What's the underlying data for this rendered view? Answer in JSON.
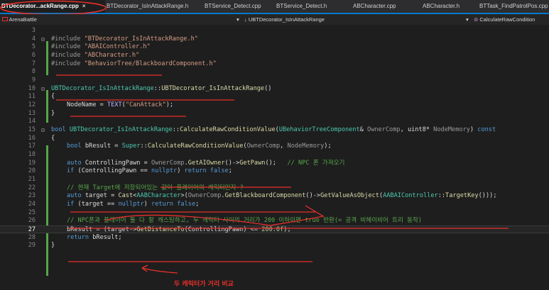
{
  "tabs": [
    {
      "label": "BTDecorator...ackRange.cpp",
      "active": true,
      "close": "×"
    },
    {
      "label": "BTDecorator_IsInAttackRange.h"
    },
    {
      "label": "BTService_Detect.cpp"
    },
    {
      "label": "BTService_Detect.h"
    },
    {
      "label": "ABCharacter.cpp"
    },
    {
      "label": "ABCharacter.h"
    },
    {
      "label": "BTTask_FindPatrolPos.cpp"
    }
  ],
  "navbar": {
    "project": "ArenaBattle",
    "scope": "UBTDecorator_IsInAttackRange",
    "member": "CalculateRawCondition"
  },
  "current_line": 27,
  "lines": [
    {
      "n": "3"
    },
    {
      "n": "4"
    },
    {
      "n": "5"
    },
    {
      "n": "6"
    },
    {
      "n": "7"
    },
    {
      "n": "8"
    },
    {
      "n": "9"
    },
    {
      "n": "10"
    },
    {
      "n": "11"
    },
    {
      "n": "12"
    },
    {
      "n": "13"
    },
    {
      "n": "14"
    },
    {
      "n": "15"
    },
    {
      "n": "16"
    },
    {
      "n": "17"
    },
    {
      "n": "18"
    },
    {
      "n": "19"
    },
    {
      "n": "20"
    },
    {
      "n": "21"
    },
    {
      "n": "22"
    },
    {
      "n": "23"
    },
    {
      "n": "24"
    },
    {
      "n": "25"
    },
    {
      "n": "26"
    },
    {
      "n": "27"
    },
    {
      "n": "28"
    },
    {
      "n": "29"
    }
  ],
  "code": {
    "l4_inc": "#include ",
    "l4_str": "\"BTDecorator_IsInAttackRange.h\"",
    "l5_inc": "#include ",
    "l5_str": "\"ABAIController.h\"",
    "l6_inc": "#include ",
    "l6_str": "\"ABCharacter.h\"",
    "l7_inc": "#include ",
    "l7_str": "\"BehaviorTree/BlackboardComponent.h\"",
    "l10_cls": "UBTDecorator_IsInAttackRange",
    "l10_sep": "::",
    "l10_fn": "UBTDecorator_IsInAttackRange",
    "l10_tail": "()",
    "l11": "{",
    "l12_a": "NodeName",
    "l12_b": " = ",
    "l12_mac": "TEXT",
    "l12_c": "(",
    "l12_str": "\"CanAttack\"",
    "l12_d": ");",
    "l13": "}",
    "l15_kw": "bool ",
    "l15_cls": "UBTDecorator_IsInAttackRange",
    "l15_sep": "::",
    "l15_fn": "CalculateRawConditionValue",
    "l15_p1": "(",
    "l15_cls2": "UBehaviorTreeComponent",
    "l15_p2": "& ",
    "l15_prm1": "OwnerComp",
    "l15_p3": ", uint8* ",
    "l15_prm2": "NodeMemory",
    "l15_p4": ") ",
    "l15_kw2": "const",
    "l16": "{",
    "l17_kw": "bool ",
    "l17_a": "bResult = ",
    "l17_cls": "Super",
    "l17_sep": "::",
    "l17_fn": "CalculateRawConditionValue",
    "l17_b": "(",
    "l17_prm1": "OwnerComp",
    "l17_c": ", ",
    "l17_prm2": "NodeMemory",
    "l17_d": ");",
    "l19_kw": "auto ",
    "l19_a": "ControllingPawn = ",
    "l19_prm": "OwnerComp",
    "l19_b": ".",
    "l19_fn1": "GetAIOwner",
    "l19_c": "()->",
    "l19_fn2": "GetPawn",
    "l19_d": "();   ",
    "l19_cm": "// NPC 폰 가져오기",
    "l20_kw": "if ",
    "l20_a": "(ControllingPawn == ",
    "l20_kw2": "nullptr",
    "l20_b": ") ",
    "l20_kw3": "return false",
    "l20_c": ";",
    "l22_cm": "// 현재 Target에 저장되어있는 값이 플레이어의 캐릭터인지 ?",
    "l23_kw": "auto ",
    "l23_a": "target = ",
    "l23_fn1": "Cast",
    "l23_b": "<",
    "l23_cls1": "AABCharacter",
    "l23_c": ">(",
    "l23_prm": "OwnerComp",
    "l23_d": ".",
    "l23_fn2": "GetBlackboardComponent",
    "l23_e": "()->",
    "l23_fn3": "GetValueAsObject",
    "l23_f": "(",
    "l23_cls2": "AABAIController",
    "l23_g": "::",
    "l23_fn4": "TargetKey",
    "l23_h": "()));",
    "l24_kw": "if ",
    "l24_a": "(target == ",
    "l24_kw2": "nullptr",
    "l24_b": ") ",
    "l24_kw3": "return false",
    "l24_c": ";",
    "l26_cm": "// NPC폰과 플레이어 둘 다 잘 캐스팅하고, 두 캐릭터 사이의 거리가 200 이하이면 true 반환(= 공격 비헤이비어 트리 동작)",
    "l27_a": "bResult = (target->",
    "l27_fn": "GetDistanceTo",
    "l27_b": "(ControllingPawn) <= ",
    "l27_num": "200.0f",
    "l27_c": ");",
    "l28_kw": "return ",
    "l28_a": "bResult;",
    "l29": "}"
  },
  "annotation": {
    "handwritten_note": "두 캐릭터가 거리 비교",
    "color": "#e8302a"
  },
  "colors": {
    "accent": "#007acc",
    "background": "#1e1e1e",
    "annotation": "#e8302a"
  },
  "icons": {
    "project": "project-icon",
    "scope": "down-arrow-icon",
    "member": "method-icon"
  }
}
